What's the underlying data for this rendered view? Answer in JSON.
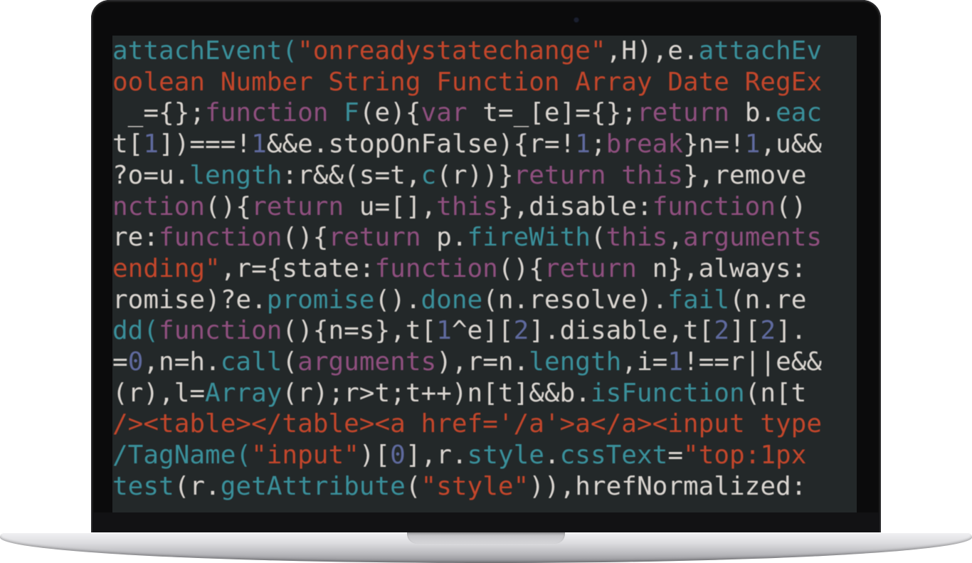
{
  "palette": {
    "default": "#d9d4cf",
    "keyword": "#8e4f7e",
    "method": "#3a8f9a",
    "string": "#c2462b",
    "number": "#5f6a9e",
    "dim": "#b9b4ad"
  },
  "code_lines": [
    {
      "tokens": [
        {
          "text": "attachEvent(",
          "color": "method"
        },
        {
          "text": "\"onreadystatechange\"",
          "color": "string"
        },
        {
          "text": ",H),e.",
          "color": "default"
        },
        {
          "text": "attachEv",
          "color": "method"
        }
      ]
    },
    {
      "tokens": [
        {
          "text": "oolean Number String Function Array Date RegEx",
          "color": "string"
        }
      ]
    },
    {
      "tokens": [
        {
          "text": " _={};",
          "color": "default"
        },
        {
          "text": "function ",
          "color": "keyword"
        },
        {
          "text": "F",
          "color": "method"
        },
        {
          "text": "(e){",
          "color": "default"
        },
        {
          "text": "var ",
          "color": "keyword"
        },
        {
          "text": "t=_[e]={};",
          "color": "default"
        },
        {
          "text": "return ",
          "color": "keyword"
        },
        {
          "text": "b.",
          "color": "default"
        },
        {
          "text": "eac",
          "color": "method"
        }
      ]
    },
    {
      "tokens": [
        {
          "text": "t[",
          "color": "default"
        },
        {
          "text": "1",
          "color": "number"
        },
        {
          "text": "])===!",
          "color": "default"
        },
        {
          "text": "1",
          "color": "number"
        },
        {
          "text": "&&e.stopOnFalse){r=!",
          "color": "default"
        },
        {
          "text": "1",
          "color": "number"
        },
        {
          "text": ";",
          "color": "default"
        },
        {
          "text": "break",
          "color": "keyword"
        },
        {
          "text": "}n=!",
          "color": "default"
        },
        {
          "text": "1",
          "color": "number"
        },
        {
          "text": ",u&&",
          "color": "default"
        }
      ]
    },
    {
      "tokens": [
        {
          "text": "?o=u.",
          "color": "default"
        },
        {
          "text": "length",
          "color": "method"
        },
        {
          "text": ":r&&(s=t,",
          "color": "default"
        },
        {
          "text": "c",
          "color": "method"
        },
        {
          "text": "(r))}",
          "color": "default"
        },
        {
          "text": "return this",
          "color": "keyword"
        },
        {
          "text": "},remove",
          "color": "default"
        }
      ]
    },
    {
      "tokens": [
        {
          "text": "nction",
          "color": "keyword"
        },
        {
          "text": "(){",
          "color": "default"
        },
        {
          "text": "return ",
          "color": "keyword"
        },
        {
          "text": "u=[],",
          "color": "default"
        },
        {
          "text": "this",
          "color": "keyword"
        },
        {
          "text": "},disable:",
          "color": "default"
        },
        {
          "text": "function",
          "color": "keyword"
        },
        {
          "text": "()",
          "color": "default"
        }
      ]
    },
    {
      "tokens": [
        {
          "text": "re:",
          "color": "default"
        },
        {
          "text": "function",
          "color": "keyword"
        },
        {
          "text": "(){",
          "color": "default"
        },
        {
          "text": "return ",
          "color": "keyword"
        },
        {
          "text": "p.",
          "color": "default"
        },
        {
          "text": "fireWith",
          "color": "method"
        },
        {
          "text": "(",
          "color": "default"
        },
        {
          "text": "this",
          "color": "keyword"
        },
        {
          "text": ",",
          "color": "default"
        },
        {
          "text": "arguments",
          "color": "keyword"
        }
      ]
    },
    {
      "tokens": [
        {
          "text": "ending\"",
          "color": "string"
        },
        {
          "text": ",r={state:",
          "color": "default"
        },
        {
          "text": "function",
          "color": "keyword"
        },
        {
          "text": "(){",
          "color": "default"
        },
        {
          "text": "return ",
          "color": "keyword"
        },
        {
          "text": "n},always:",
          "color": "default"
        }
      ]
    },
    {
      "tokens": [
        {
          "text": "romise)?e.",
          "color": "default"
        },
        {
          "text": "promise",
          "color": "method"
        },
        {
          "text": "().",
          "color": "default"
        },
        {
          "text": "done",
          "color": "method"
        },
        {
          "text": "(n.resolve).",
          "color": "default"
        },
        {
          "text": "fail",
          "color": "method"
        },
        {
          "text": "(n.re",
          "color": "default"
        }
      ]
    },
    {
      "tokens": [
        {
          "text": "dd(",
          "color": "method"
        },
        {
          "text": "function",
          "color": "keyword"
        },
        {
          "text": "(){n=s},t[",
          "color": "default"
        },
        {
          "text": "1",
          "color": "number"
        },
        {
          "text": "^e][",
          "color": "default"
        },
        {
          "text": "2",
          "color": "number"
        },
        {
          "text": "].disable,t[",
          "color": "default"
        },
        {
          "text": "2",
          "color": "number"
        },
        {
          "text": "][",
          "color": "default"
        },
        {
          "text": "2",
          "color": "number"
        },
        {
          "text": "].",
          "color": "default"
        }
      ]
    },
    {
      "tokens": [
        {
          "text": "=",
          "color": "default"
        },
        {
          "text": "0",
          "color": "number"
        },
        {
          "text": ",n=h.",
          "color": "default"
        },
        {
          "text": "call",
          "color": "method"
        },
        {
          "text": "(",
          "color": "default"
        },
        {
          "text": "arguments",
          "color": "keyword"
        },
        {
          "text": "),r=n.",
          "color": "default"
        },
        {
          "text": "length",
          "color": "method"
        },
        {
          "text": ",i=",
          "color": "default"
        },
        {
          "text": "1",
          "color": "number"
        },
        {
          "text": "!==r||e&&",
          "color": "default"
        }
      ]
    },
    {
      "tokens": [
        {
          "text": "(r),l=",
          "color": "default"
        },
        {
          "text": "Array",
          "color": "method"
        },
        {
          "text": "(r);r>t;t++)n[t]&&b.",
          "color": "default"
        },
        {
          "text": "isFunction",
          "color": "method"
        },
        {
          "text": "(n[t",
          "color": "default"
        }
      ]
    },
    {
      "tokens": [
        {
          "text": "/><table></table><a href='/a'>a</a><input type",
          "color": "string"
        }
      ]
    },
    {
      "tokens": [
        {
          "text": "/TagName(",
          "color": "method"
        },
        {
          "text": "\"input\"",
          "color": "string"
        },
        {
          "text": ")[",
          "color": "default"
        },
        {
          "text": "0",
          "color": "number"
        },
        {
          "text": "],r.",
          "color": "default"
        },
        {
          "text": "style",
          "color": "method"
        },
        {
          "text": ".",
          "color": "default"
        },
        {
          "text": "cssText",
          "color": "method"
        },
        {
          "text": "=",
          "color": "default"
        },
        {
          "text": "\"top:1px",
          "color": "string"
        }
      ]
    },
    {
      "tokens": [
        {
          "text": "test",
          "color": "method"
        },
        {
          "text": "(r.",
          "color": "default"
        },
        {
          "text": "getAttribute",
          "color": "method"
        },
        {
          "text": "(",
          "color": "default"
        },
        {
          "text": "\"style\"",
          "color": "string"
        },
        {
          "text": ")),hrefNormalized:",
          "color": "default"
        }
      ]
    }
  ]
}
